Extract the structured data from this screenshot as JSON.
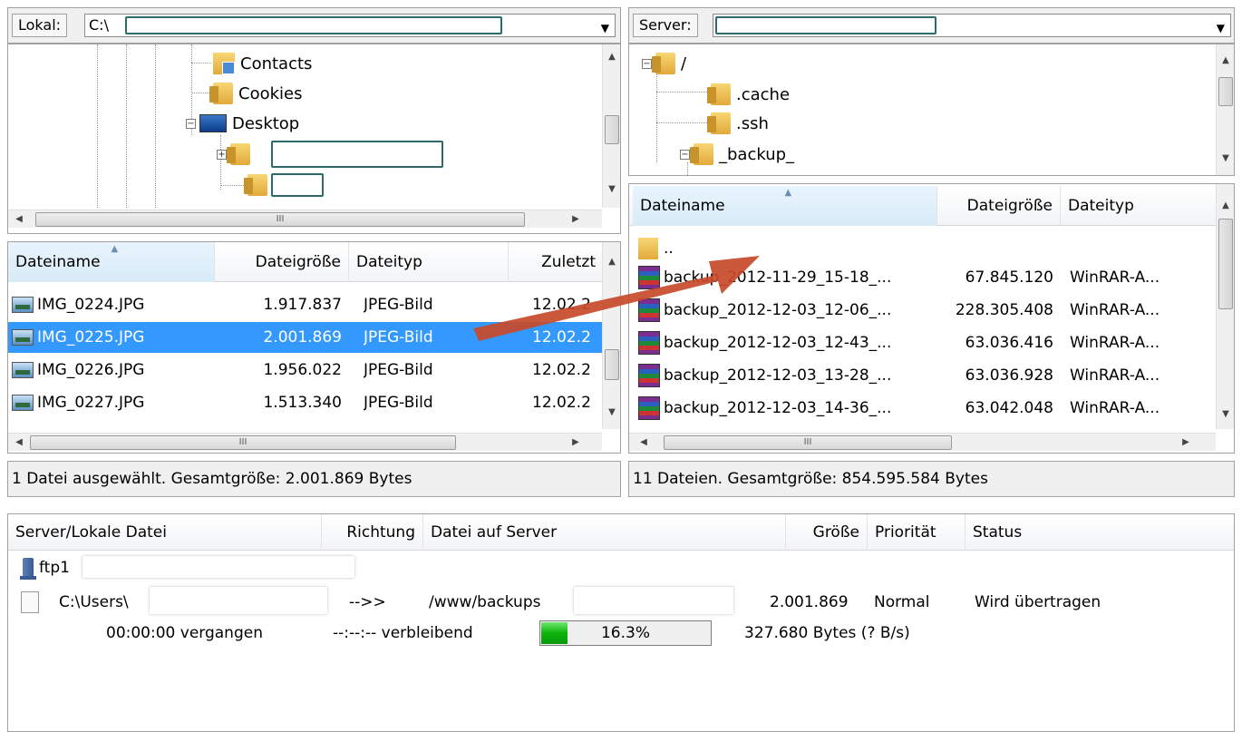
{
  "local": {
    "label": "Lokal:",
    "path": "C:\\",
    "tree": [
      {
        "name": "Contacts"
      },
      {
        "name": "Cookies"
      },
      {
        "name": "Desktop"
      }
    ],
    "scroll_glyph": "III",
    "columns": [
      "Dateiname",
      "Dateigröße",
      "Dateityp",
      "Zuletzt"
    ],
    "files": [
      {
        "name": "IMG_0224.JPG",
        "size": "1.917.837",
        "type": "JPEG-Bild",
        "date": "12.02.2"
      },
      {
        "name": "IMG_0225.JPG",
        "size": "2.001.869",
        "type": "JPEG-Bild",
        "date": "12.02.2",
        "selected": true
      },
      {
        "name": "IMG_0226.JPG",
        "size": "1.956.022",
        "type": "JPEG-Bild",
        "date": "12.02.2"
      },
      {
        "name": "IMG_0227.JPG",
        "size": "1.513.340",
        "type": "JPEG-Bild",
        "date": "12.02.2"
      }
    ],
    "status": "1 Datei ausgewählt. Gesamtgröße: 2.001.869 Bytes"
  },
  "server": {
    "label": "Server:",
    "path": "",
    "tree": [
      {
        "name": "/"
      },
      {
        "name": ".cache"
      },
      {
        "name": ".ssh"
      },
      {
        "name": "_backup_"
      }
    ],
    "scroll_glyph": "III",
    "columns": [
      "Dateiname",
      "Dateigröße",
      "Dateityp"
    ],
    "parent": "..",
    "files": [
      {
        "name": "backup_2012-11-29_15-18_...",
        "size": "67.845.120",
        "type": "WinRAR-A..."
      },
      {
        "name": "backup_2012-12-03_12-06_...",
        "size": "228.305.408",
        "type": "WinRAR-A..."
      },
      {
        "name": "backup_2012-12-03_12-43_...",
        "size": "63.036.416",
        "type": "WinRAR-A..."
      },
      {
        "name": "backup_2012-12-03_13-28_...",
        "size": "63.036.928",
        "type": "WinRAR-A..."
      },
      {
        "name": "backup_2012-12-03_14-36_...",
        "size": "63.042.048",
        "type": "WinRAR-A..."
      }
    ],
    "status": "11 Dateien. Gesamtgröße: 854.595.584 Bytes"
  },
  "queue": {
    "columns": [
      "Server/Lokale Datei",
      "Richtung",
      "Datei auf Server",
      "Größe",
      "Priorität",
      "Status"
    ],
    "server_name": "ftp1",
    "local_file": "C:\\Users\\",
    "direction": "-->>",
    "remote_file": "/www/backups",
    "size": "2.001.869",
    "priority": "Normal",
    "status": "Wird übertragen",
    "elapsed": "00:00:00 vergangen",
    "remaining": "--:--:-- verbleibend",
    "progress_percent": 16.3,
    "progress_label": "16.3%",
    "rate": "327.680 Bytes (? B/s)"
  },
  "colors": {
    "selection": "#3399ff",
    "arrow": "#c84a2a",
    "progress": "#0bb30b"
  }
}
